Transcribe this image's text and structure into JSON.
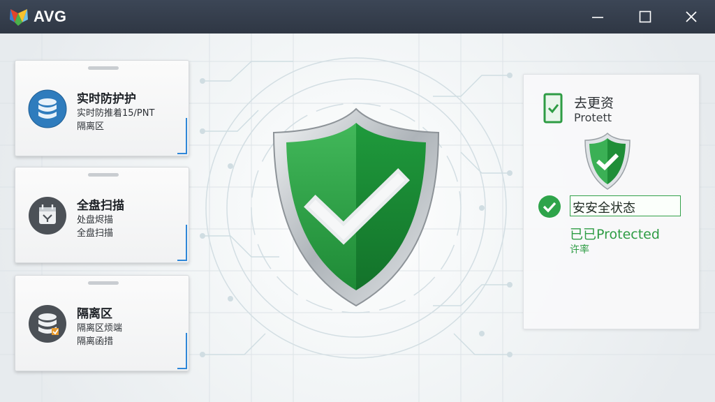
{
  "app": {
    "name": "AVG"
  },
  "window_controls": {
    "minimize_icon": "minimize-icon",
    "maximize_icon": "maximize-icon",
    "close_icon": "close-icon"
  },
  "cards": [
    {
      "icon": "database-icon",
      "title": "实时防护护",
      "line1": "实时防推着15/PNT",
      "line2": "隔离区"
    },
    {
      "icon": "scan-icon",
      "title": "全盘扫描",
      "line1": "处盘烬描",
      "line2": "全盘扫描"
    },
    {
      "icon": "quarantine-icon",
      "title": "隔离区",
      "line1": "隔离区烦端",
      "line2": "隔离函措"
    }
  ],
  "status_panel": {
    "icon": "phone-check-icon",
    "title": "去更资",
    "subtitle": "Protett",
    "status_value": "安安全状态",
    "status_line1": "已已Protected",
    "status_line2": "许率"
  },
  "colors": {
    "titlebar": "#333c4a",
    "accent_green": "#2e9c44",
    "shield_green": "#1f9a3c",
    "card_accent_blue": "#2f87d8",
    "icon_blue": "#2e78b8"
  }
}
